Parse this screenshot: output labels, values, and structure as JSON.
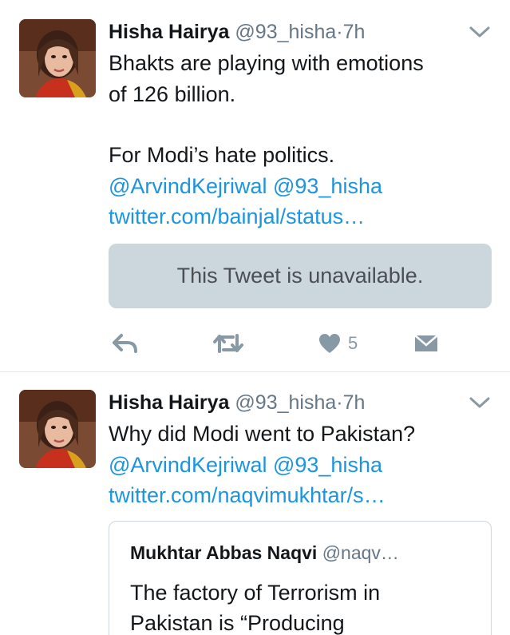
{
  "tweets": [
    {
      "author_name": "Hisha Hairya",
      "handle": "@93_hisha",
      "separator": "·",
      "time": "7h",
      "text_lines": [
        "Bhakts are playing with emotions",
        "of 126 billion."
      ],
      "text_line_2": [
        "For Modi’s hate politics."
      ],
      "mentions": "@ArvindKejriwal @93_hisha",
      "link": "twitter.com/bainjal/status…",
      "unavailable_card": "This Tweet is unavailable.",
      "actions": {
        "reply_icon": "reply-icon",
        "retweet_icon": "retweet-icon",
        "like_icon": "heart-icon",
        "like_count": "5",
        "dm_icon": "envelope-icon"
      }
    },
    {
      "author_name": "Hisha Hairya",
      "handle": "@93_hisha",
      "separator": "·",
      "time": "7h",
      "text_lines": [
        "Why did Modi went to Pakistan?"
      ],
      "mentions": "@ArvindKejriwal @93_hisha",
      "link": "twitter.com/naqvimukhtar/s…",
      "quoted": {
        "author_name": "Mukhtar Abbas Naqvi",
        "handle": "@naqv…",
        "text_lines": [
          "The factory of Terrorism in",
          "Pakistan is “Producing"
        ]
      }
    }
  ],
  "colors": {
    "link": "#1b95e0",
    "secondary_text": "#657786",
    "card_background": "#ccd6dd",
    "icon": "#8899a6",
    "divider": "#e1e8ed"
  }
}
